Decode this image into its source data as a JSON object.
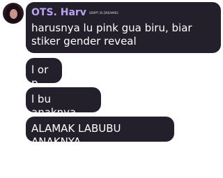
{
  "message_group": {
    "sender_name": "OTS. Harv",
    "sender_tag": "SEMPT 4S DREAMIES"
  },
  "messages": [
    {
      "text": "harusnya lu pink gua biru, biar stiker gender reveal"
    },
    {
      "text": "l or p"
    },
    {
      "text": "l bu anaknya"
    },
    {
      "text": "ALAMAK LABUBU ANAKNYA"
    }
  ]
}
